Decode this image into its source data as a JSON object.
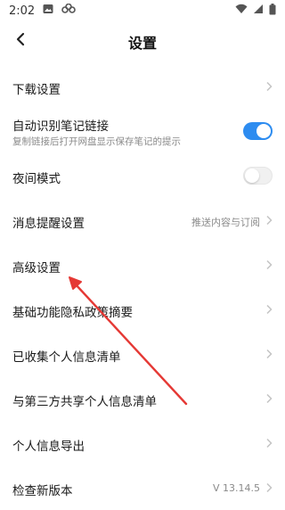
{
  "status_bar": {
    "time": "2:02"
  },
  "header": {
    "title": "设置"
  },
  "settings": [
    {
      "label": "下载设置"
    },
    {
      "label": "自动识别笔记链接",
      "sublabel": "复制链接后打开网盘显示保存笔记的提示",
      "toggle": "on"
    },
    {
      "label": "夜间模式",
      "toggle": "off"
    },
    {
      "label": "消息提醒设置",
      "value": "推送内容与订阅"
    },
    {
      "label": "高级设置"
    },
    {
      "label": "基础功能隐私政策摘要"
    },
    {
      "label": "已收集个人信息清单"
    },
    {
      "label": "与第三方共享个人信息清单"
    },
    {
      "label": "个人信息导出"
    },
    {
      "label": "检查新版本",
      "value": "V 13.14.5"
    }
  ],
  "colors": {
    "accent": "#2d8cf0",
    "annotation_arrow": "#e53935"
  }
}
